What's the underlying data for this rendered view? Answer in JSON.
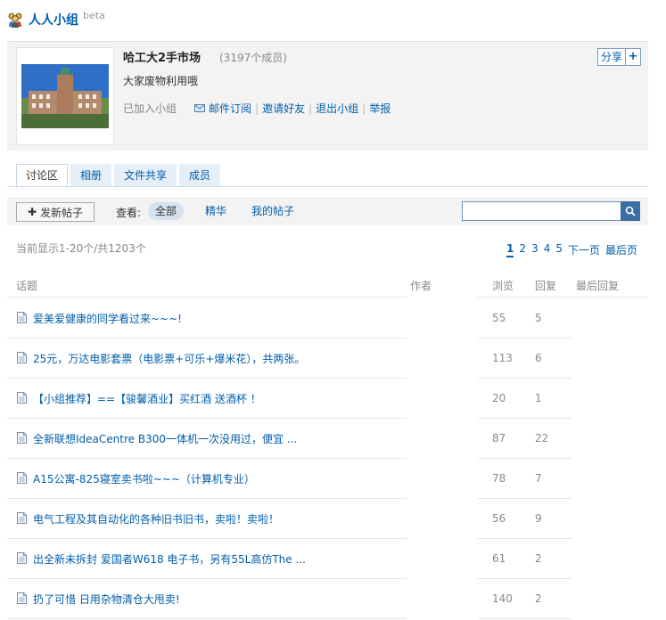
{
  "brand": {
    "title": "人人小组",
    "beta": "beta",
    "logo_icon": "people-group-icon"
  },
  "group": {
    "name": "哈工大2手市场",
    "member_count": "(3197个成员)",
    "description": "大家废物利用哦",
    "joined_label": "已加入小组",
    "actions": [
      {
        "label": "邮件订阅",
        "icon": "mail-icon"
      },
      {
        "label": "邀请好友"
      },
      {
        "label": "退出小组"
      },
      {
        "label": "举报"
      }
    ],
    "share_label": "分享",
    "share_plus": "+"
  },
  "tabs": [
    {
      "label": "讨论区",
      "active": true
    },
    {
      "label": "相册"
    },
    {
      "label": "文件共享"
    },
    {
      "label": "成员"
    }
  ],
  "toolbar": {
    "new_post_icon": "plus-icon",
    "new_post_plus": "✚",
    "new_post_label": "发新帖子",
    "view_label": "查看:",
    "filters": [
      {
        "label": "全部",
        "active": true
      },
      {
        "label": "精华"
      },
      {
        "label": "我的帖子"
      }
    ],
    "search_placeholder": ""
  },
  "listing": {
    "range_text": "当前显示1-20个/共1203个",
    "pages": [
      "1",
      "2",
      "3",
      "4",
      "5"
    ],
    "current_page": "1",
    "next_label": "下一页",
    "last_label": "最后页"
  },
  "columns": {
    "topic": "话题",
    "author": "作者",
    "views": "浏览",
    "replies": "回复",
    "last_reply": "最后回复"
  },
  "threads": [
    {
      "title": "爱美爱健康的同学看过来~~~!",
      "views": "55",
      "replies": "5"
    },
    {
      "title": "25元，万达电影套票（电影票+可乐+爆米花），共两张。",
      "views": "113",
      "replies": "6"
    },
    {
      "title": "【小组推荐】==【骏馨酒业】买红酒 送酒杯 ！",
      "views": "20",
      "replies": "1"
    },
    {
      "title": "全新联想IdeaCentre B300一体机一次没用过，便宜 ...",
      "views": "87",
      "replies": "22"
    },
    {
      "title": "A15公寓-825寝室卖书啦~~~（计算机专业）",
      "views": "78",
      "replies": "7"
    },
    {
      "title": "电气工程及其自动化的各种旧书旧书，卖啦！卖啦！",
      "views": "56",
      "replies": "9"
    },
    {
      "title": "出全新未拆封 爱国者W618 电子书，另有55L高仿The ...",
      "views": "61",
      "replies": "2"
    },
    {
      "title": "扔了可惜 日用杂物清仓大甩卖!",
      "views": "140",
      "replies": "2"
    }
  ]
}
